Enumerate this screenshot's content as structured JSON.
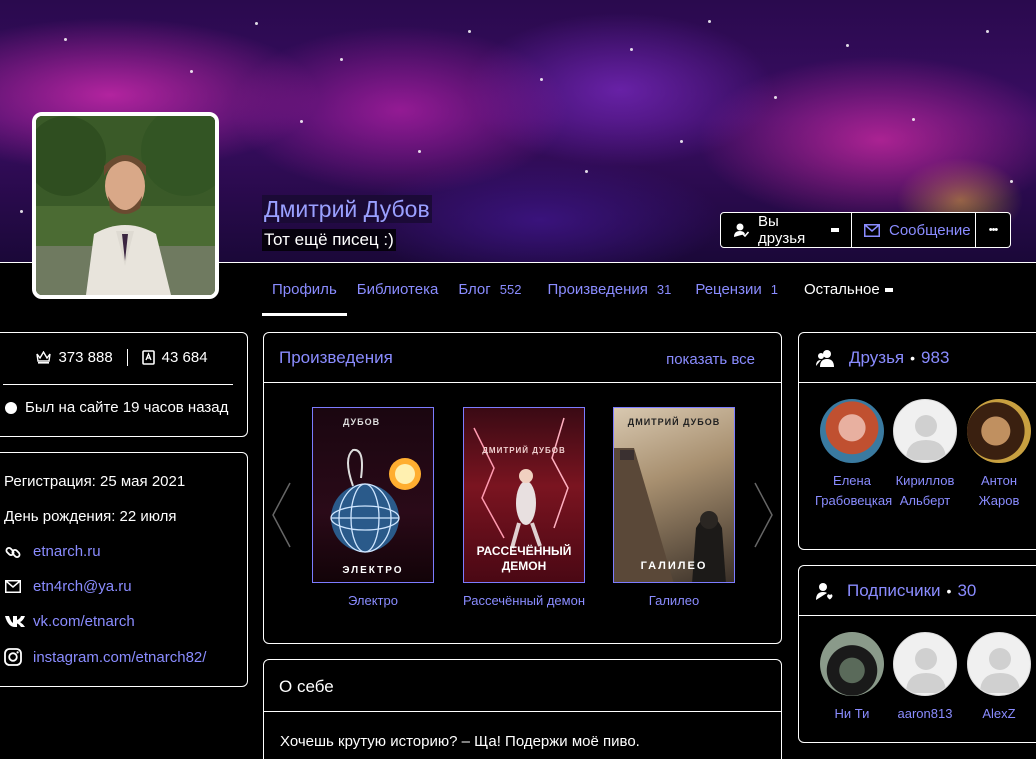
{
  "profile": {
    "name": "Дмитрий Дубов",
    "status": "Тот ещё писец :)"
  },
  "buttons": {
    "friends_label": "Вы друзья",
    "message_label": "Сообщение",
    "more_label": "•••"
  },
  "nav": {
    "profile": "Профиль",
    "library": "Библиотека",
    "blog": "Блог",
    "blog_count": "552",
    "works": "Произведения",
    "works_count": "31",
    "reviews": "Рецензии",
    "reviews_count": "1",
    "other": "Остальное"
  },
  "stats": {
    "rating": "373 888",
    "books": "43 684",
    "online": "Был на сайте 19 часов назад"
  },
  "info": {
    "registration": "Регистрация: 25 мая 2021",
    "birthday": "День рождения: 22 июля",
    "site": "etnarch.ru",
    "email": "etn4rch@ya.ru",
    "vk": "vk.com/etnarch",
    "instagram": "instagram.com/etnarch82/"
  },
  "works": {
    "title": "Произведения",
    "show_all": "показать все",
    "books": [
      {
        "title": "Электро",
        "cover_author": "ДУБОВ",
        "cover_title": "ЭЛЕКТРО"
      },
      {
        "title": "Рассечённый демон",
        "cover_author": "ДМИТРИЙ ДУБОВ",
        "cover_title": "РАССЕЧЁННЫЙ ДЕМОН"
      },
      {
        "title": "Галилео",
        "cover_author": "ДМИТРИЙ ДУБОВ",
        "cover_title": "ГАЛИЛЕО"
      }
    ]
  },
  "about": {
    "title": "О себе",
    "text": "Хочешь крутую историю? – Ща! Подержи моё пиво."
  },
  "friends": {
    "title": "Друзья",
    "count": "983",
    "people": [
      {
        "name": "Елена Грабовецкая"
      },
      {
        "name": "Кириллов Альберт"
      },
      {
        "name": "Антон Жаров"
      }
    ]
  },
  "subscribers": {
    "title": "Подписчики",
    "count": "30",
    "people": [
      {
        "name": "Ни Ти"
      },
      {
        "name": "aaron813"
      },
      {
        "name": "AlexZ"
      }
    ]
  },
  "colors": {
    "accent": "#8a8cff",
    "background": "#000000",
    "border": "#ffffff"
  }
}
